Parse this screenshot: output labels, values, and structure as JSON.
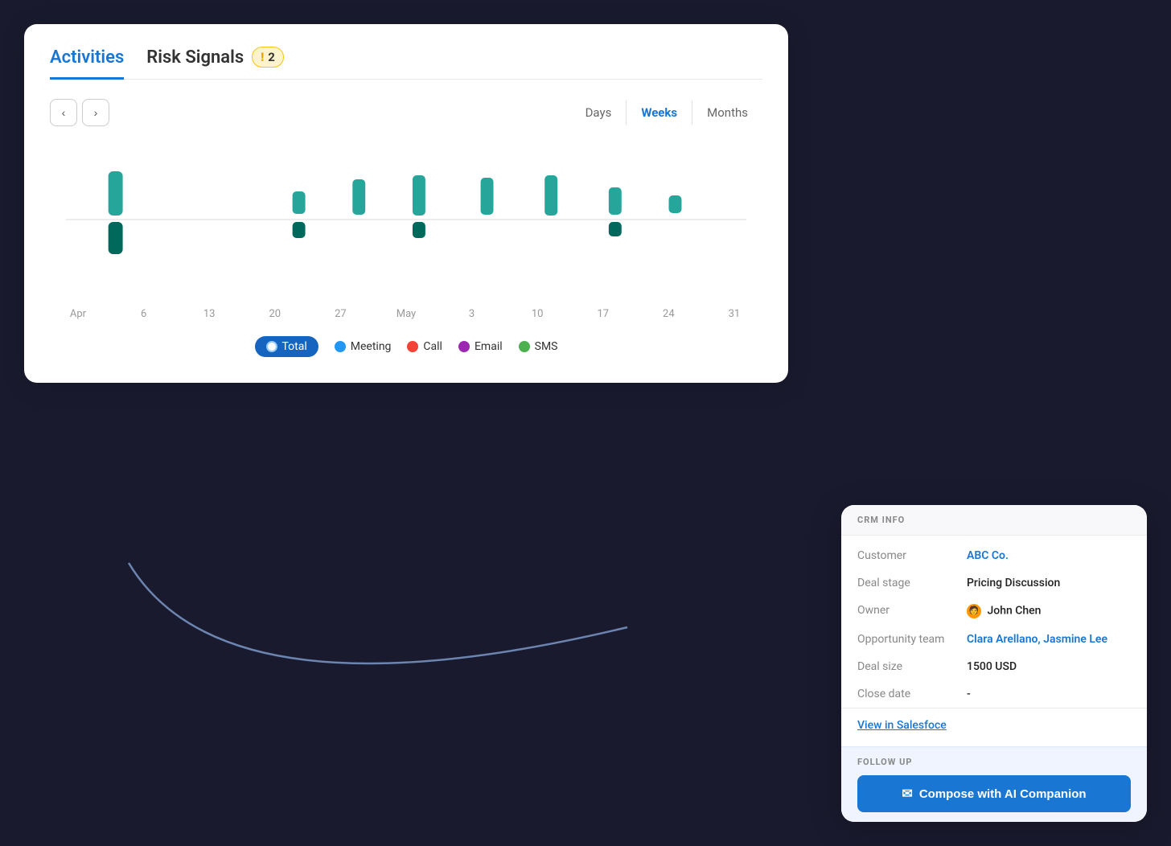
{
  "tabs": {
    "activities": "Activities",
    "riskSignals": "Risk Signals",
    "riskCount": "2"
  },
  "viewToggles": {
    "days": "Days",
    "weeks": "Weeks",
    "months": "Months",
    "active": "Weeks"
  },
  "xAxis": {
    "labels": [
      "Apr",
      "6",
      "13",
      "20",
      "27",
      "May",
      "3",
      "10",
      "17",
      "24",
      "31"
    ]
  },
  "legend": {
    "total": "Total",
    "meeting": "Meeting",
    "call": "Call",
    "email": "Email",
    "sms": "SMS",
    "colors": {
      "total": "#1976d2",
      "meeting": "#2196f3",
      "call": "#f44336",
      "email": "#9c27b0",
      "sms": "#4caf50"
    }
  },
  "crm": {
    "header": "CRM INFO",
    "customer_label": "Customer",
    "customer_value": "ABC Co.",
    "deal_stage_label": "Deal stage",
    "deal_stage_value": "Pricing Discussion",
    "owner_label": "Owner",
    "owner_value": "John Chen",
    "opp_team_label": "Opportunity team",
    "opp_team_value": "Clara Arellano, Jasmine Lee",
    "deal_size_label": "Deal size",
    "deal_size_value": "1500 USD",
    "close_date_label": "Close date",
    "close_date_value": "-",
    "view_link": "View in Salesfoce",
    "follow_up_label": "FOLLOW UP",
    "compose_label": "Compose with AI Companion"
  },
  "nav": {
    "prev": "‹",
    "next": "›"
  }
}
